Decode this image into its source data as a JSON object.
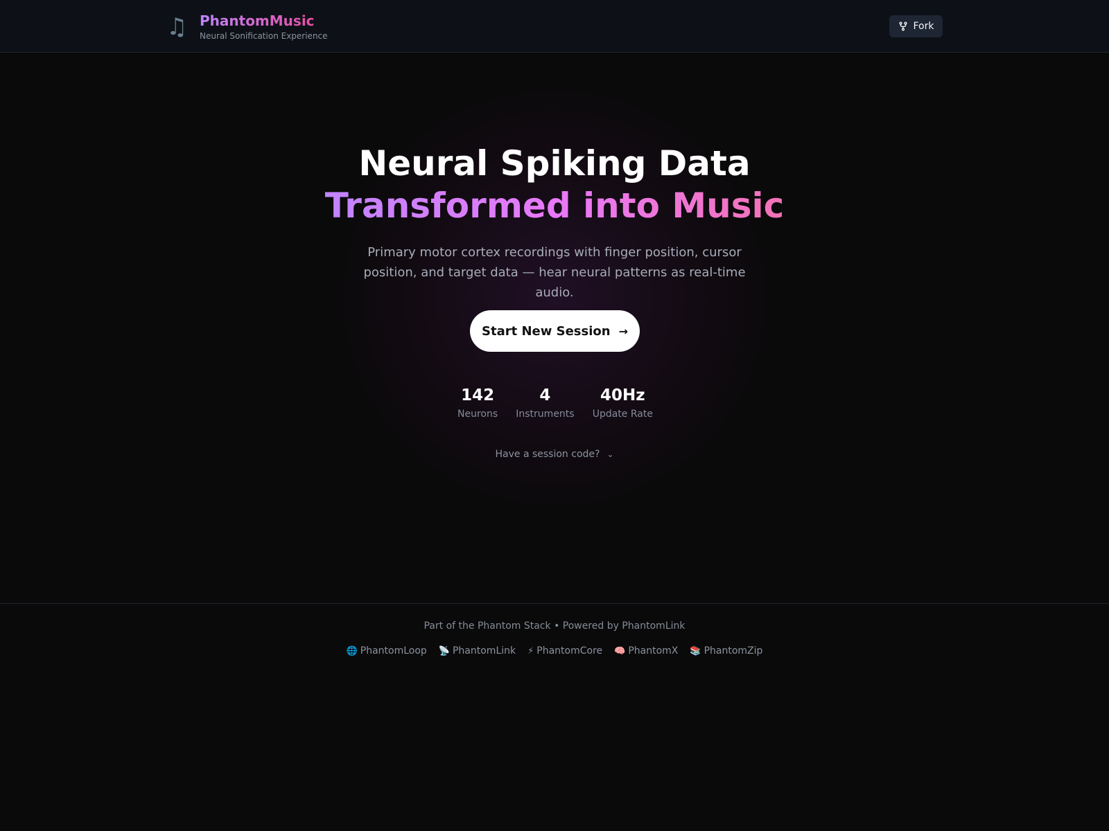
{
  "header": {
    "brand_icon": "music-note-icon",
    "title": "PhantomMusic",
    "subtitle": "Neural Sonification Experience",
    "fork_label": "Fork",
    "fork_icon": "git-fork-icon"
  },
  "hero": {
    "title_line1": "Neural Spiking Data",
    "title_line2": "Transformed into Music",
    "description": "Primary motor cortex recordings with finger position, cursor position, and target data — hear neural patterns as real-time audio.",
    "cta_label": "Start New Session",
    "cta_icon": "arrow-right-icon",
    "stats": [
      {
        "value": "142",
        "label": "Neurons"
      },
      {
        "value": "4",
        "label": "Instruments"
      },
      {
        "value": "40Hz",
        "label": "Update Rate"
      }
    ],
    "session_code_label": "Have a session code?",
    "session_code_icon": "chevron-down-icon"
  },
  "footer": {
    "text": "Part of the Phantom Stack • Powered by PhantomLink",
    "links": [
      {
        "icon": "🌐",
        "label": "PhantomLoop"
      },
      {
        "icon": "📡",
        "label": "PhantomLink"
      },
      {
        "icon": "⚡",
        "label": "PhantomCore"
      },
      {
        "icon": "🧠",
        "label": "PhantomX"
      },
      {
        "icon": "📚",
        "label": "PhantomZip"
      }
    ]
  },
  "colors": {
    "background": "#0a0a0a",
    "header_bg": "#0d1117",
    "accent_purple": "#c084fc",
    "accent_pink": "#f472b6"
  }
}
